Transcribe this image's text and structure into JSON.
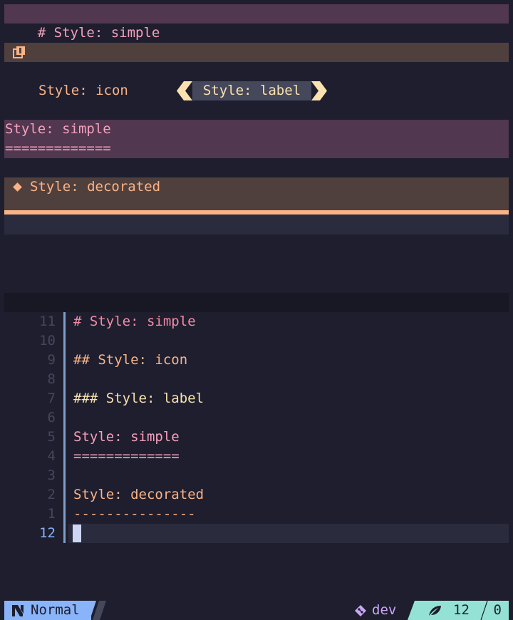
{
  "preview": {
    "h1_text": "# Style: simple",
    "h2_text": "Style: icon",
    "h3_text": "Style: label",
    "setext1_text": "Style: simple",
    "setext1_underline": "=============",
    "setext2_text": "Style: decorated"
  },
  "editor": {
    "lines": [
      {
        "num": "11",
        "text": "# Style: simple",
        "cls": "c-h1"
      },
      {
        "num": "10",
        "text": "",
        "cls": ""
      },
      {
        "num": "9",
        "text": "## Style: icon",
        "cls": "c-h2"
      },
      {
        "num": "8",
        "text": "",
        "cls": ""
      },
      {
        "num": "7",
        "text": "### Style: label",
        "cls": "c-h3"
      },
      {
        "num": "6",
        "text": "",
        "cls": ""
      },
      {
        "num": "5",
        "text": "Style: simple",
        "cls": "c-h1b"
      },
      {
        "num": "4",
        "text": "=============",
        "cls": "c-h1b"
      },
      {
        "num": "3",
        "text": "",
        "cls": ""
      },
      {
        "num": "2",
        "text": "Style: decorated",
        "cls": "c-h2"
      },
      {
        "num": "1",
        "text": "---------------",
        "cls": "c-h2"
      },
      {
        "num": "12",
        "text": "",
        "cls": ""
      }
    ]
  },
  "statusline": {
    "mode": "Normal",
    "branch": "dev",
    "line": "12",
    "col": "0"
  },
  "colors": {
    "accent_blue": "#89b4fa",
    "peach": "#fab387",
    "pink": "#f5a0bc",
    "yellow": "#f9e2af",
    "teal": "#94e2d5",
    "mauve": "#cba6f7"
  }
}
